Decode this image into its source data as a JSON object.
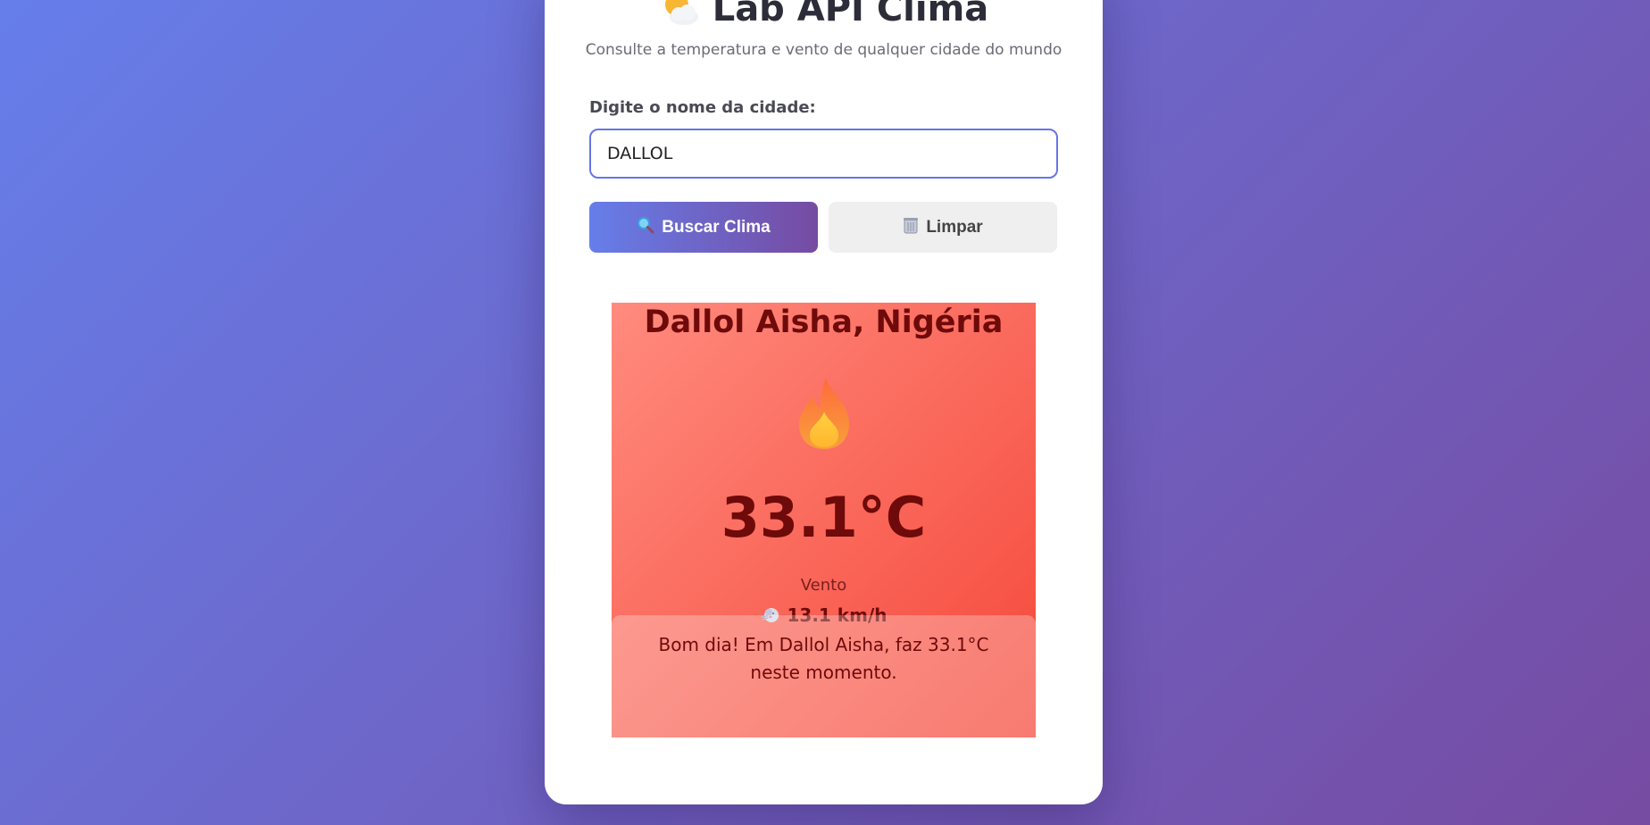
{
  "app": {
    "title": "Lab API Clima",
    "subtitle": "Consulte a temperatura e vento de qualquer cidade do mundo"
  },
  "search": {
    "label": "Digite o nome da cidade:",
    "value": "DALLOL",
    "search_button": "Buscar Clima",
    "clear_button": "Limpar"
  },
  "result": {
    "city": "Dallol Aisha, Nigéria",
    "temperature": "33.1°C",
    "wind_label": "Vento",
    "wind_value": "13.1 km/h",
    "message": "Bom dia! Em Dallol Aisha, faz 33.1°C neste momento.",
    "icon": "fire-icon"
  },
  "colors": {
    "background_start": "#667eea",
    "background_end": "#764ba2",
    "result_start": "#ff8b7e",
    "result_end": "#f5483a",
    "text_dark_red": "#6e0a0a"
  }
}
